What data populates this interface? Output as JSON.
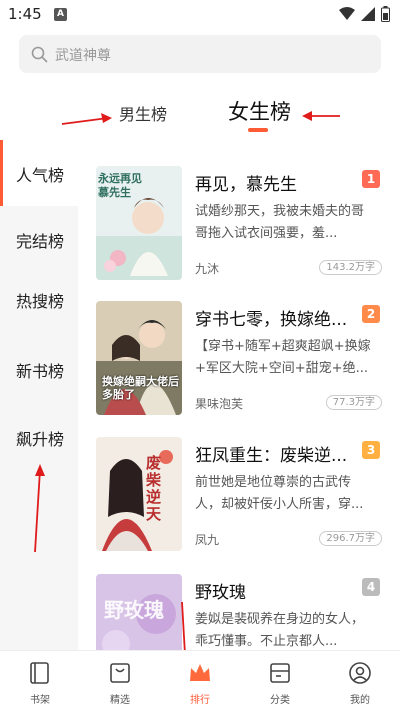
{
  "status_bar": {
    "time": "1:45",
    "notif": "A"
  },
  "search": {
    "placeholder": "武道神尊"
  },
  "gender_tabs": {
    "male": "男生榜",
    "female": "女生榜",
    "accent": "#ff5b35"
  },
  "sidebar": {
    "items": [
      {
        "label": "人气榜",
        "active": true
      },
      {
        "label": "完结榜",
        "active": false
      },
      {
        "label": "热搜榜",
        "active": false
      },
      {
        "label": "新书榜",
        "active": false
      },
      {
        "label": "飙升榜",
        "active": false
      }
    ]
  },
  "books": [
    {
      "rank": "1",
      "rank_color": "#ff6a55",
      "title": "再见，慕先生",
      "desc": "试婚纱那天，我被未婚夫的哥哥拖入试衣间强要，羞...",
      "author": "九沐",
      "count": "143.2万字",
      "cover_title": "永远再见慕先生"
    },
    {
      "rank": "2",
      "rank_color": "#ff8a4a",
      "title": "穿书七零，换嫁绝...",
      "desc": "【穿书+随军+超爽超飒+换嫁+军区大院+空间+甜宠+绝...",
      "author": "果味泡芙",
      "count": "77.3万字",
      "cover_title": "换嫁绝嗣大佬后多胎了"
    },
    {
      "rank": "3",
      "rank_color": "#ffb040",
      "title": "狂凤重生：废柴逆...",
      "desc": "前世她是地位尊崇的古武传人，却被奸佞小人所害，穿...",
      "author": "凤九",
      "count": "296.7万字",
      "cover_title": "废柴逆天"
    },
    {
      "rank": "4",
      "rank_color": "#bbbbbb",
      "title": "野玫瑰",
      "desc": "姜姒是裴砚养在身边的女人，乖巧懂事。不止京都人...",
      "author": "",
      "count": "",
      "cover_title": "野玫瑰"
    }
  ],
  "bottom_nav": [
    {
      "label": "书架",
      "icon": "bookshelf-icon",
      "active": false
    },
    {
      "label": "精选",
      "icon": "featured-icon",
      "active": false
    },
    {
      "label": "排行",
      "icon": "crown-icon",
      "active": true
    },
    {
      "label": "分类",
      "icon": "category-icon",
      "active": false
    },
    {
      "label": "我的",
      "icon": "profile-icon",
      "active": false
    }
  ]
}
